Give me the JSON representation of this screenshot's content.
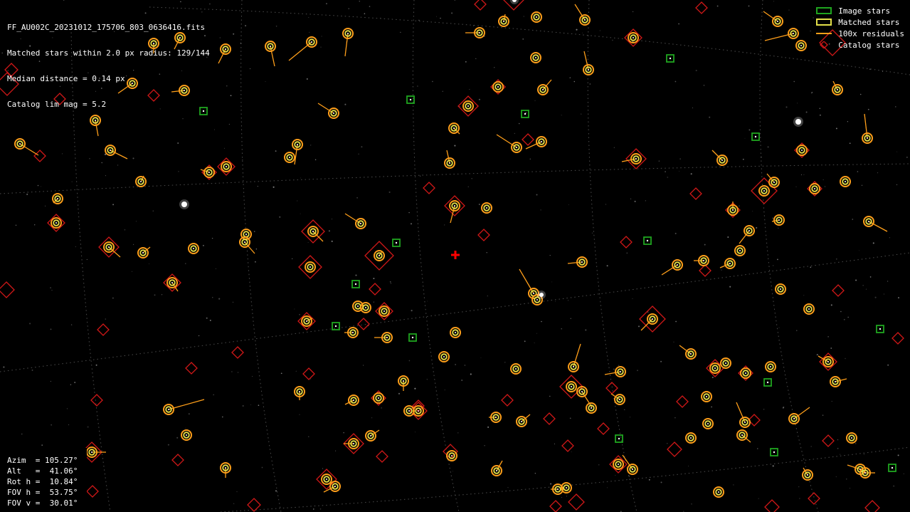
{
  "header": {
    "lines": [
      "FF_AU002C_20231012_175706_803_0636416.fits",
      "Matched stars within 2.0 px radius: 129/144",
      "Median distance = 0.14 px",
      "Catalog lim mag = 5.2"
    ]
  },
  "legend": {
    "items": [
      {
        "label": "Image stars",
        "color": "#1fa51f"
      },
      {
        "label": "Matched stars",
        "color": "#e3e04a"
      },
      {
        "label": "100x residuals",
        "color": "#ff9f1a"
      },
      {
        "label": "Catalog stars",
        "color": "#d01818"
      }
    ]
  },
  "pointing": {
    "lines": [
      "Azim  = 105.27°",
      "Alt   =  41.06°",
      "Rot h =  10.84°",
      "FOV h =  53.75°",
      "FOV v =  30.01°"
    ]
  },
  "colors": {
    "background": "#000000",
    "grid": "#8a8a8a",
    "image_star": "#1fa51f",
    "matched_star": "#e3e04a",
    "residual": "#ff9f1a",
    "catalog_star": "#d01818",
    "center_marker": "#ff0000"
  }
}
